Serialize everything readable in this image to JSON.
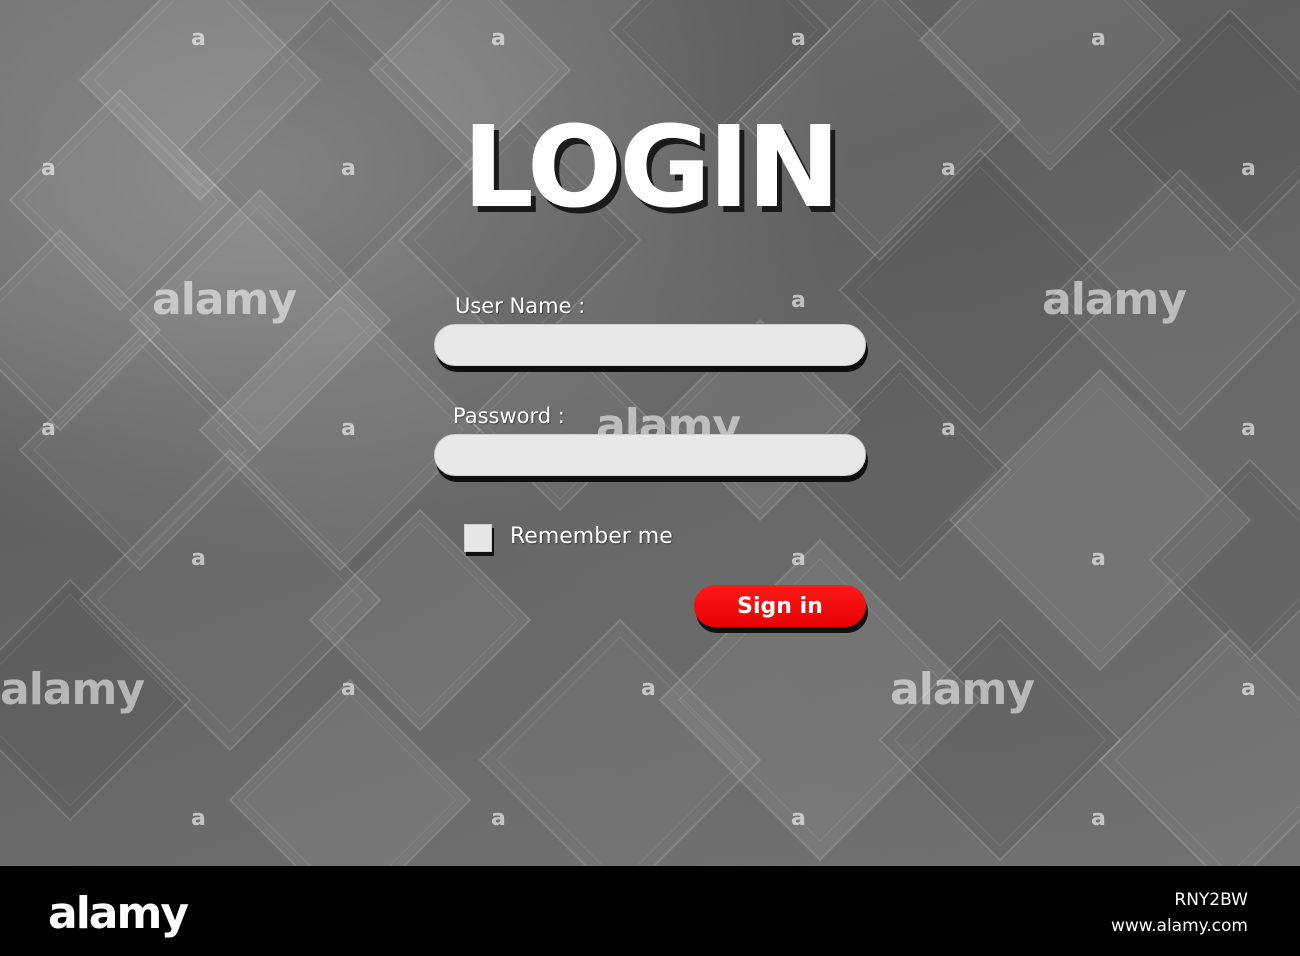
{
  "form": {
    "title": "LOGIN",
    "username_label": "User Name :",
    "username_value": "",
    "password_label": "Password :",
    "password_value": "",
    "remember_label": "Remember me",
    "remember_checked": false,
    "signin_label": "Sign in"
  },
  "watermark": {
    "brand": "alamy",
    "mark": "a"
  },
  "footer": {
    "logo": "alamy",
    "image_id": "RNY2BW",
    "url": "www.alamy.com"
  },
  "colors": {
    "background": "#666666",
    "field_fill": "#e8e8e8",
    "signin_button": "#ff0000",
    "text": "#ffffff",
    "footer": "#000000"
  }
}
